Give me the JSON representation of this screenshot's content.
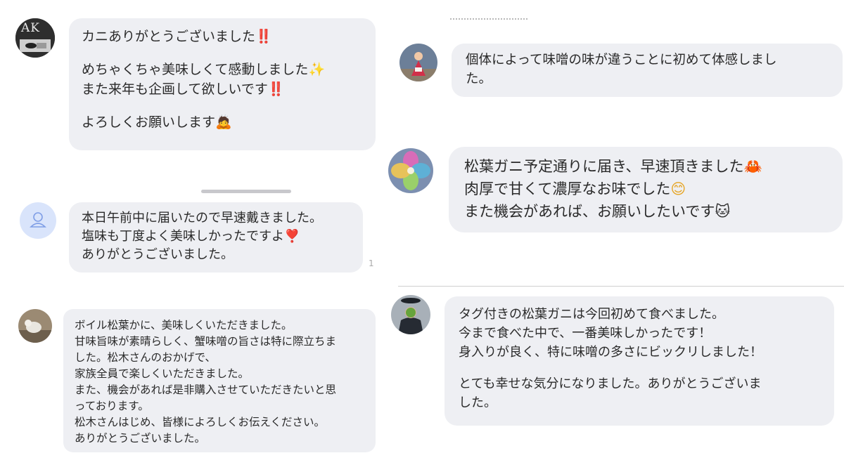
{
  "messages": {
    "m1": {
      "avatar_text": "AK",
      "line1": "カニありがとうございました",
      "line2": "めちゃくちゃ美味しくて感動しました",
      "line3": "また来年も企画して欲しいです",
      "line4": "よろしくお願いします",
      "emoji1": "‼️",
      "emoji2": "✨",
      "emoji3": "‼️",
      "emoji4": "🙇"
    },
    "m2": {
      "line1": "本日午前中に届いたので早速戴きました。",
      "line2": "塩味も丁度よく美味しかったですよ",
      "line3": "ありがとうございました。",
      "emoji1": "❣️",
      "side_mark": "1"
    },
    "m3": {
      "line1": "ボイル松葉かに、美味しくいただきました。",
      "line2": "甘味旨味が素晴らしく、蟹味噌の旨さは特に際立ちま",
      "line3": "した。松木さんのおかげで、",
      "line4": "家族全員で楽しくいただきました。",
      "line5": "また、機会があれば是非購入させていただきたいと思",
      "line6": "っております。",
      "line7": "松木さんはじめ、皆様によろしくお伝えください。",
      "line8": "ありがとうございました。"
    },
    "m4": {
      "line1": "個体によって味噌の味が違うことに初めて体感しまし",
      "line2": "た。"
    },
    "m5": {
      "line1": "松葉ガニ予定通りに届き、早速頂きました",
      "line2": "肉厚で甘くて濃厚なお味でした",
      "line3": "また機会があれば、お願いしたいです",
      "emoji1": "🦀",
      "emoji2": "😊",
      "emoji3": "🐱"
    },
    "m6": {
      "line1": "タグ付きの松葉ガニは今回初めて食べました。",
      "line2": "今まで食べた中で、一番美味しかったです！",
      "line3": "身入りが良く、特に味噌の多さにビックリしました！",
      "line4": "とても幸せな気分になりました。ありがとうございま",
      "line5": "した。"
    }
  },
  "icons": {
    "default_avatar": "person-outline-icon"
  },
  "colors": {
    "bubble": "#eeeff3",
    "text": "#2a2a2a",
    "divider": "#d0d0d0",
    "exclaim_red": "#d81b1b",
    "heart_red": "#e0293a"
  }
}
